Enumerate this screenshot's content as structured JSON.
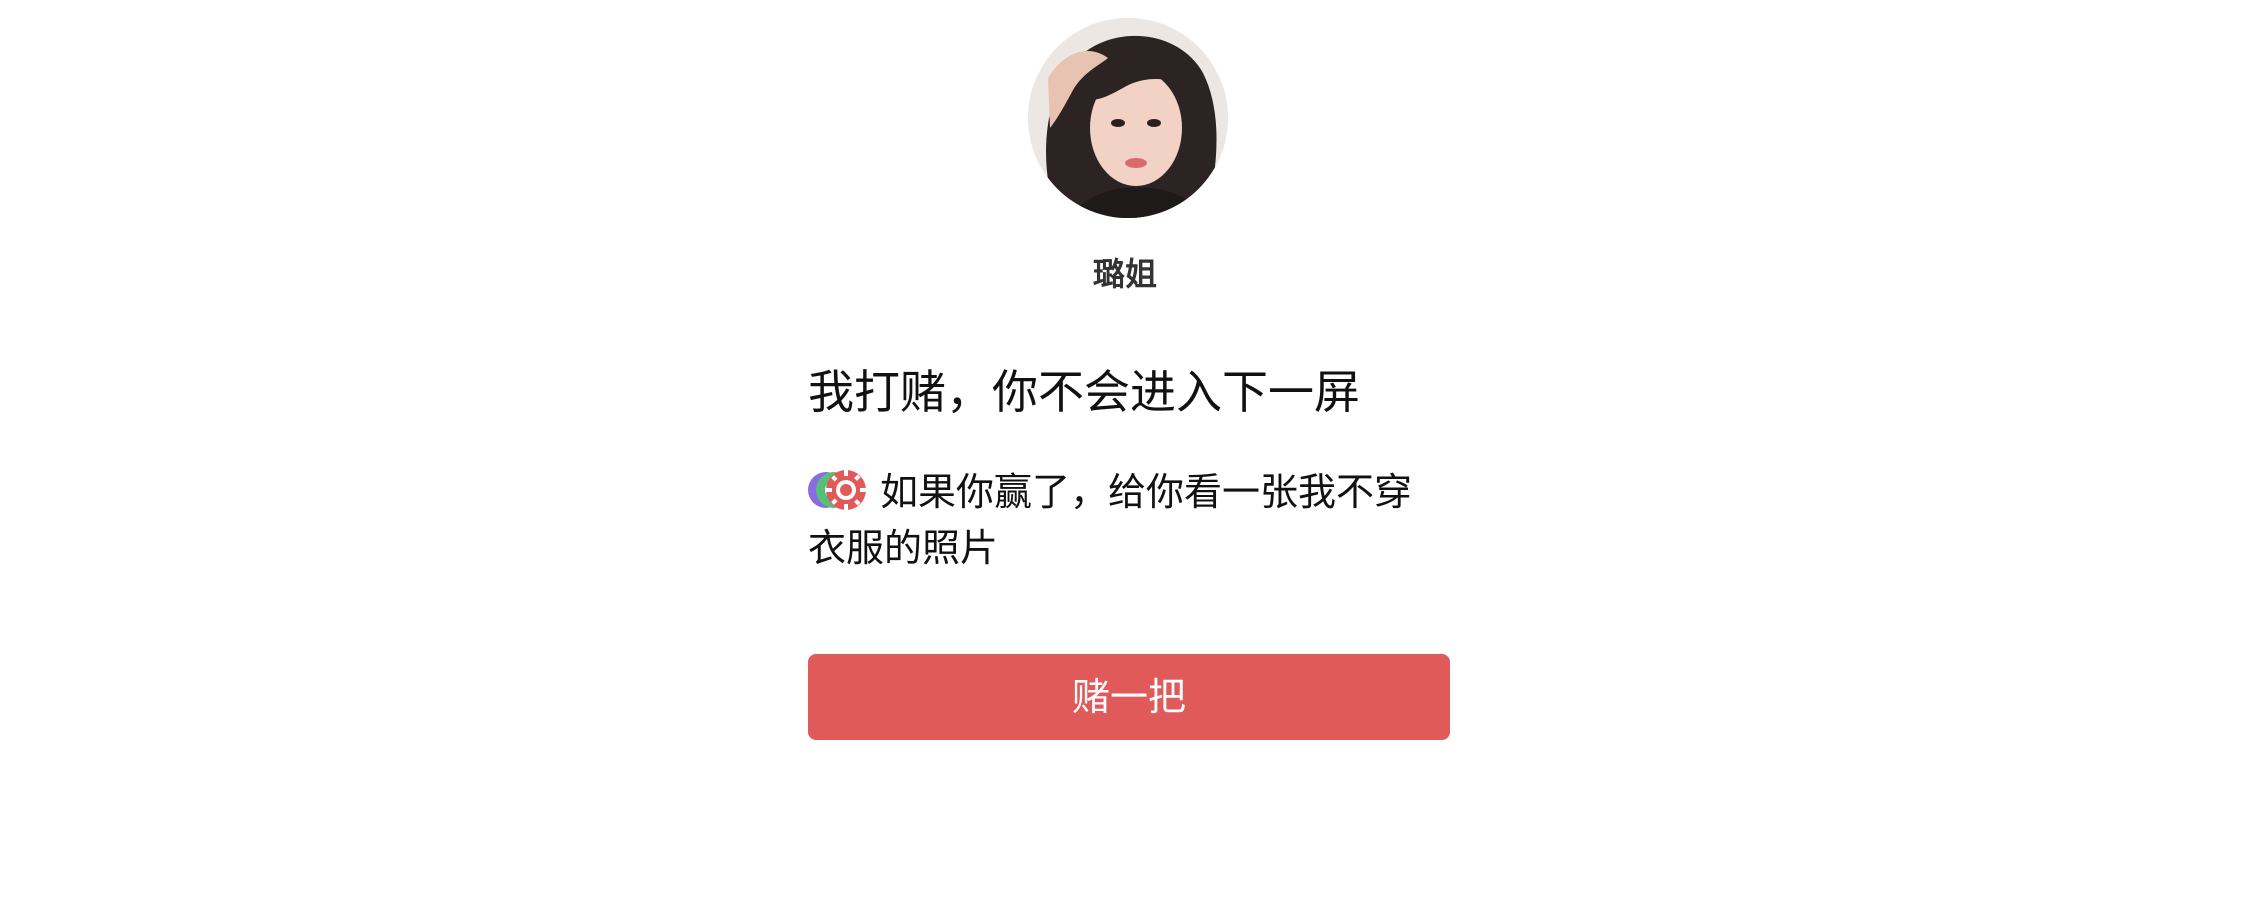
{
  "profile": {
    "username": "璐姐"
  },
  "message": {
    "headline": "我打赌，你不会进入下一屏",
    "subline": "如果你赢了，给你看一张我不穿衣服的照片",
    "icon": "poker-chip-icon"
  },
  "action": {
    "button_label": "赌一把"
  },
  "colors": {
    "button": "#e05a5a",
    "button_text": "#ffffff",
    "chip_red": "#e05a5a",
    "chip_purple": "#8a6be0",
    "chip_green": "#55c07a"
  }
}
